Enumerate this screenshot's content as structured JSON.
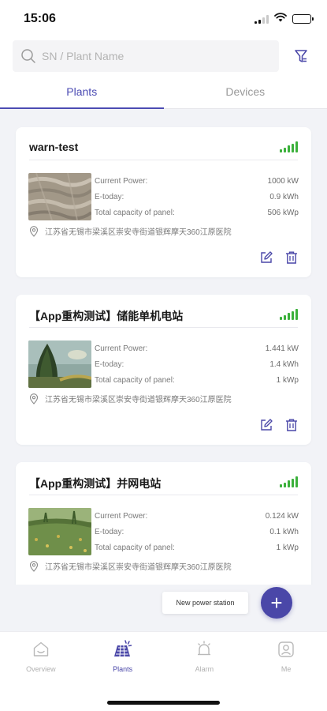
{
  "status_bar": {
    "time": "15:06"
  },
  "search": {
    "placeholder": "SN / Plant Name"
  },
  "tabs": [
    {
      "label": "Plants",
      "active": true
    },
    {
      "label": "Devices",
      "active": false
    }
  ],
  "plants": [
    {
      "name": "warn-test",
      "signal_bars": 5,
      "current_power_label": "Current Power:",
      "current_power": "1000 kW",
      "e_today_label": "E-today:",
      "e_today": "0.9 kWh",
      "capacity_label": "Total capacity of panel:",
      "capacity": "506 kWp",
      "address": "江苏省无锡市梁溪区崇安寺街道银辉摩天360江原医院"
    },
    {
      "name": "【App重构测试】储能单机电站",
      "signal_bars": 5,
      "current_power_label": "Current Power:",
      "current_power": "1.441 kW",
      "e_today_label": "E-today:",
      "e_today": "1.4 kWh",
      "capacity_label": "Total capacity of panel:",
      "capacity": "1 kWp",
      "address": "江苏省无锡市梁溪区崇安寺街道银辉摩天360江原医院"
    },
    {
      "name": "【App重构测试】并网电站",
      "signal_bars": 5,
      "current_power_label": "Current Power:",
      "current_power": "0.124 kW",
      "e_today_label": "E-today:",
      "e_today": "0.1 kWh",
      "capacity_label": "Total capacity of panel:",
      "capacity": "1 kWp",
      "address": "江苏省无锡市梁溪区崇安寺街道银辉摩天360江原医院"
    }
  ],
  "fab": {
    "label": "New power station",
    "symbol": "+"
  },
  "bottom_nav": [
    {
      "label": "Overview",
      "icon": "house-icon",
      "active": false
    },
    {
      "label": "Plants",
      "icon": "solar-plant-icon",
      "active": true
    },
    {
      "label": "Alarm",
      "icon": "alarm-bell-icon",
      "active": false
    },
    {
      "label": "Me",
      "icon": "user-icon",
      "active": false
    }
  ],
  "colors": {
    "accent": "#4a47a8",
    "tab_active": "#4b4bb3",
    "signal_green": "#3ab03a",
    "background": "#f2f3f7"
  }
}
